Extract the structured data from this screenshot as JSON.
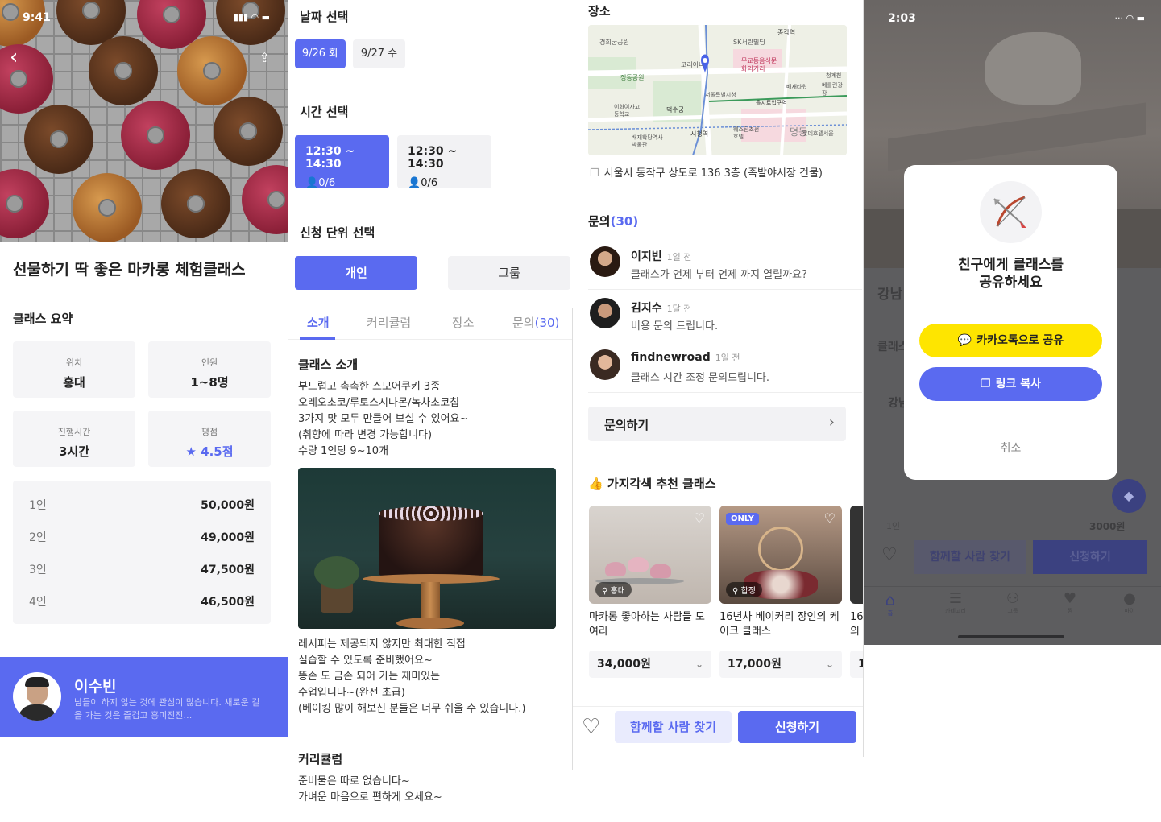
{
  "panel1": {
    "status_time": "9:41",
    "title": "선물하기 딱 좋은 마카롱 체험클래스",
    "summary_heading": "클래스 요약",
    "summary": [
      {
        "label": "위치",
        "value": "홍대"
      },
      {
        "label": "인원",
        "value": "1~8명"
      },
      {
        "label": "진행시간",
        "value": "3시간"
      },
      {
        "label": "평점",
        "value": "★ 4.5점"
      }
    ],
    "prices": [
      {
        "people": "1인",
        "price": "50,000원"
      },
      {
        "people": "2인",
        "price": "49,000원"
      },
      {
        "people": "3인",
        "price": "47,500원"
      },
      {
        "people": "4인",
        "price": "46,500원"
      }
    ],
    "host": {
      "name": "이수빈",
      "bio_line1": "남들이 하지 않는 것에 관심이 많습니다. 새로운 길",
      "bio_line2": "을 가는 것은 즐겁고 흥미진진…"
    }
  },
  "panel2": {
    "date_heading": "날짜 선택",
    "dates": [
      "9/26 화",
      "9/27 수"
    ],
    "time_heading": "시간 선택",
    "times": [
      {
        "time": "12:30 ~ 14:30",
        "count": "0/6"
      },
      {
        "time": "12:30 ~ 14:30",
        "count": "0/6"
      }
    ],
    "unit_heading": "신청 단위 선택",
    "units": [
      "개인",
      "그룹"
    ],
    "tabs": [
      "소개",
      "커리큘럼",
      "장소",
      "문의"
    ],
    "tab_count": "(30)",
    "intro_heading": "클래스 소개",
    "intro_lines": [
      "부드럽고 촉촉한 스모어쿠키 3종",
      "오레오초코/루토스시나몬/녹차초코칩",
      "3가지 맛 모두 만들어 보실 수 있어요~",
      "(취향에 따라 변경 가능합니다)",
      "수량 1인당 9~10개"
    ],
    "intro_lines2": [
      "레시피는 제공되지 않지만 최대한 직접",
      "실습할 수 있도록 준비했어요~",
      "똥손 도 금손 되어 가는 재미있는",
      "수업입니다~(완전 초급)",
      "(베이킹 많이 해보신 분들은 너무 쉬울 수 있습니다.)"
    ],
    "curriculum_heading": "커리큘럼",
    "curriculum_lines": [
      "준비물은 따로 없습니다~",
      "가벼운 마음으로 편하게 오세요~"
    ]
  },
  "panel3": {
    "place_heading": "장소",
    "map_labels": [
      "종각역",
      "SK서린빌딩",
      "경희궁공원",
      "코리아나",
      "무교동음식문화의거리",
      "정동공원",
      "청계천",
      "배재타워",
      "베를린광장",
      "서울특별시청",
      "을지로입구역",
      "이화여자고등학교",
      "덕수궁",
      "배재학당역사박물관",
      "시청역",
      "웨스틴조선호텔",
      "명동",
      "롯데호텔서울"
    ],
    "address": "서울시 동작구 상도로 136 3층 (족발야시장 건물)",
    "qa_heading": "문의",
    "qa_count": "(30)",
    "questions": [
      {
        "name": "이지빈",
        "ago": "1일 전",
        "msg": "클래스가 언제 부터 언제 까지 열릴까요?"
      },
      {
        "name": "김지수",
        "ago": "1달 전",
        "msg": "비용 문의 드립니다."
      },
      {
        "name": "findnewroad",
        "ago": "1일 전",
        "msg": "클래스 시간 조정 문의드립니다."
      }
    ],
    "ask_button": "문의하기",
    "rec_heading": "가지각색 추천 클래스",
    "recommendations": [
      {
        "location": "홍대",
        "title": "마카롱 좋아하는 사람들 모여라",
        "price": "34,000원"
      },
      {
        "badge": "ONLY",
        "location": "합정",
        "title": "16년차 베이커리 장인의 케이크 클래스",
        "price": "17,000원"
      }
    ],
    "rec_peek_title": "16",
    "rec_peek_title2": "의",
    "rec_peek_price": "1",
    "find_partner": "함께할 사람 찾기",
    "apply": "신청하기"
  },
  "panel4": {
    "status_time": "2:03",
    "modal_title_line1": "친구에게 클래스를",
    "modal_title_line2": "공유하세요",
    "kakao_share": "카카오톡으로 공유",
    "copy_link": "링크 복사",
    "cancel": "취소",
    "bg_label1": "강남",
    "bg_label2": "클래스",
    "bg_label3": "강남",
    "bg_price_people": "1인",
    "bg_price": "3000원",
    "find_partner": "함께할 사람 찾기",
    "apply": "신청하기",
    "nav": [
      "홈",
      "카테고리",
      "그룹",
      "찜",
      "마이"
    ]
  },
  "colors": {
    "accent": "#5a6af0",
    "kakao": "#fee500"
  }
}
